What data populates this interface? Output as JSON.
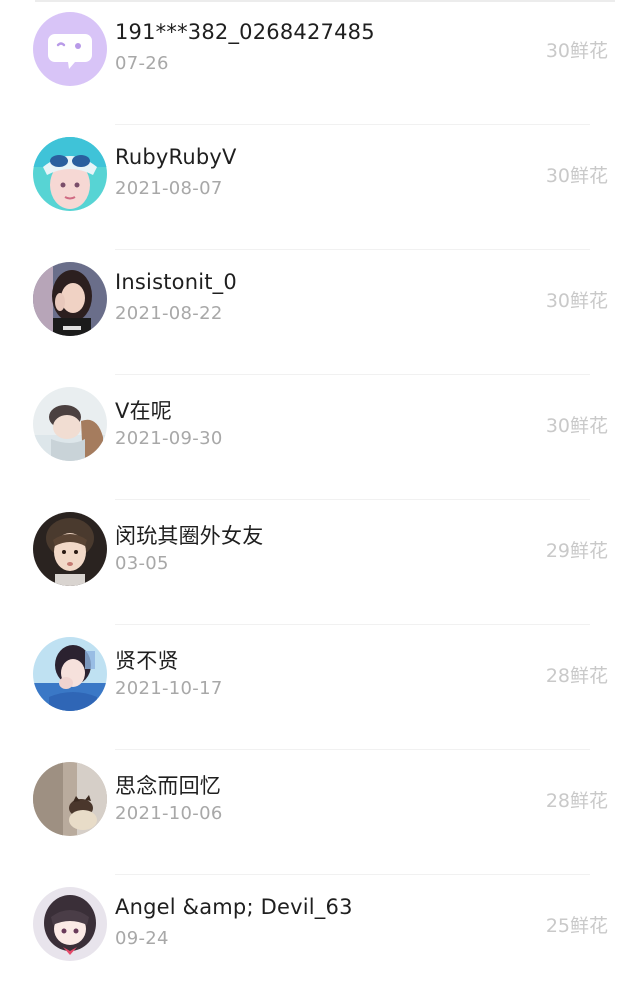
{
  "list": [
    {
      "name": "191***382_0268427485",
      "date": "07-26",
      "flowers": "30鲜花",
      "avatar": "chat-bubble-avatar"
    },
    {
      "name": "RubyRubyV",
      "date": "2021-08-07",
      "flowers": "30鲜花",
      "avatar": "anime-boy-avatar"
    },
    {
      "name": "Insistonit_0",
      "date": "2021-08-22",
      "flowers": "30鲜花",
      "avatar": "girl-photo-avatar"
    },
    {
      "name": "V在呢",
      "date": "2021-09-30",
      "flowers": "30鲜花",
      "avatar": "sleeping-boy-avatar"
    },
    {
      "name": "闵玧其圈外女友",
      "date": "03-05",
      "flowers": "29鲜花",
      "avatar": "boy-portrait-avatar"
    },
    {
      "name": "贤不贤",
      "date": "2021-10-17",
      "flowers": "28鲜花",
      "avatar": "girl-blue-avatar"
    },
    {
      "name": "思念而回忆",
      "date": "2021-10-06",
      "flowers": "28鲜花",
      "avatar": "cat-photo-avatar"
    },
    {
      "name": "Angel &amp; Devil_63",
      "date": "09-24",
      "flowers": "25鲜花",
      "avatar": "anime-girl-avatar"
    }
  ]
}
